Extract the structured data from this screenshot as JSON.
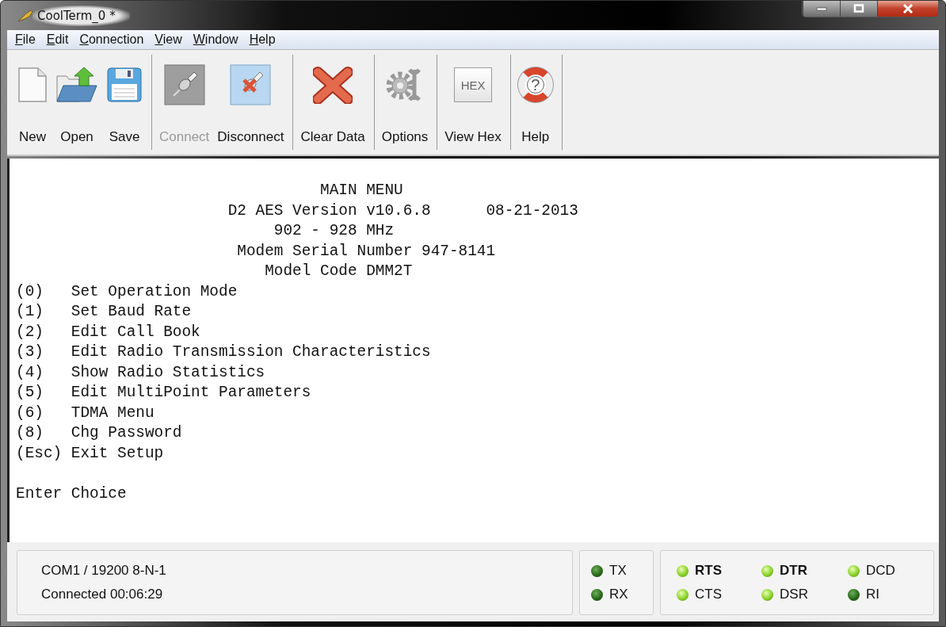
{
  "window": {
    "title": "CoolTerm_0 *",
    "controls": [
      {
        "kind": "minimize"
      },
      {
        "kind": "maximize"
      },
      {
        "kind": "close"
      }
    ]
  },
  "menu": [
    "File",
    "Edit",
    "Connection",
    "View",
    "Window",
    "Help"
  ],
  "toolbar": [
    [
      {
        "label": "New",
        "kind": "new",
        "disabled": false
      },
      {
        "label": "Open",
        "kind": "open",
        "disabled": false
      },
      {
        "label": "Save",
        "kind": "save",
        "disabled": false
      }
    ],
    [
      {
        "label": "Connect",
        "kind": "connect",
        "disabled": true
      },
      {
        "label": "Disconnect",
        "kind": "disconnect",
        "disabled": false
      }
    ],
    [
      {
        "label": "Clear Data",
        "kind": "clear",
        "disabled": false
      }
    ],
    [
      {
        "label": "Options",
        "kind": "options",
        "disabled": false
      }
    ],
    [
      {
        "label": "View Hex",
        "kind": "hex",
        "icon_text": "HEX",
        "disabled": false
      }
    ],
    [
      {
        "label": "Help",
        "kind": "help",
        "icon_text": "?",
        "disabled": false
      }
    ]
  ],
  "terminal": {
    "lines": [
      "                                 MAIN MENU",
      "                       D2 AES Version v10.6.8      08-21-2013",
      "                            902 - 928 MHz",
      "                        Modem Serial Number 947-8141",
      "                           Model Code DMM2T",
      "(0)   Set Operation Mode",
      "(1)   Set Baud Rate",
      "(2)   Edit Call Book",
      "(3)   Edit Radio Transmission Characteristics",
      "(4)   Show Radio Statistics",
      "(5)   Edit MultiPoint Parameters",
      "(6)   TDMA Menu",
      "(8)   Chg Password",
      "(Esc) Exit Setup"
    ],
    "prompt": "Enter Choice"
  },
  "status_bar": {
    "port": "COM1 / 19200 8-N-1",
    "connection": "Connected 00:06:29",
    "traffic": [
      {
        "label": "TX",
        "on": false
      },
      {
        "label": "RX",
        "on": false
      }
    ],
    "lines": [
      {
        "label": "RTS",
        "on": true,
        "bold": true
      },
      {
        "label": "DTR",
        "on": true,
        "bold": true
      },
      {
        "label": "DCD",
        "on": true,
        "bold": false
      },
      {
        "label": "CTS",
        "on": true,
        "bold": false
      },
      {
        "label": "DSR",
        "on": true,
        "bold": false
      },
      {
        "label": "RI",
        "on": false,
        "bold": false
      }
    ]
  }
}
